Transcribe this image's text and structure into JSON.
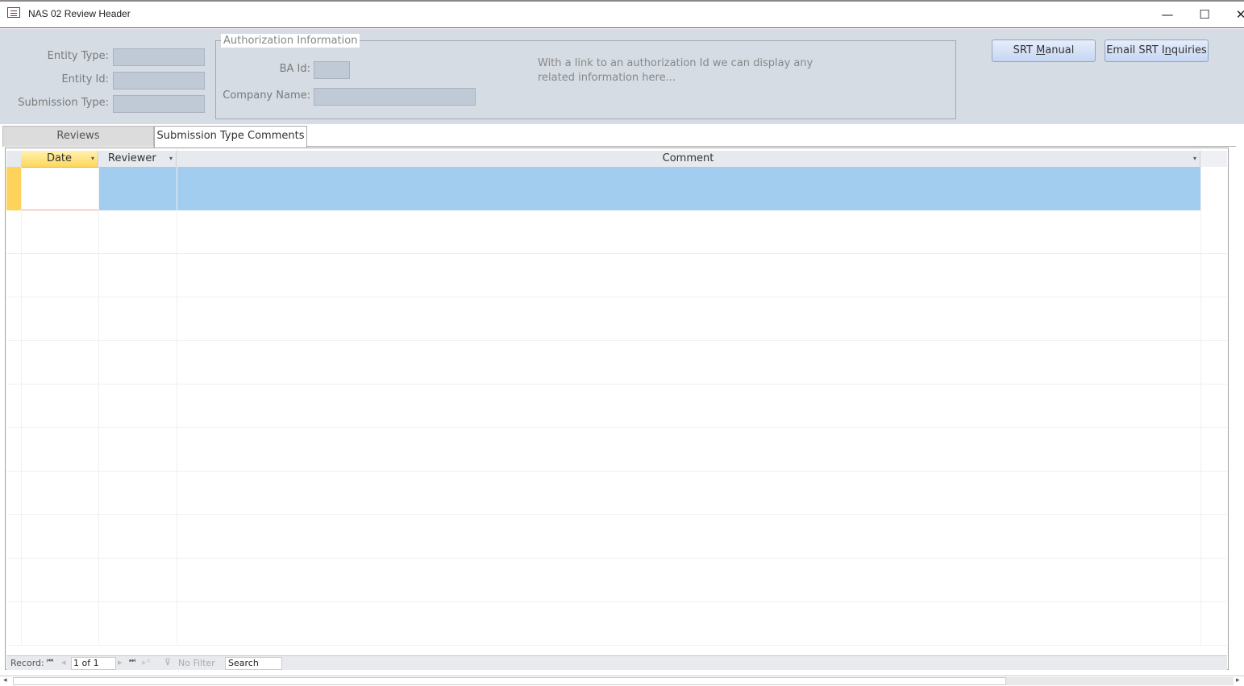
{
  "window": {
    "title": "NAS 02 Review Header",
    "minimize": "—",
    "maximize": "☐",
    "close": "✕"
  },
  "header": {
    "entity_type_label": "Entity Type:",
    "entity_id_label": "Entity Id:",
    "submission_type_label": "Submission Type:",
    "auth_group_title": "Authorization Information",
    "ba_id_label": "BA Id:",
    "company_name_label": "Company Name:",
    "info_text_1": "With a link to an authorization Id we can display any",
    "info_text_2": "related information here...",
    "srt_manual_pre": "SRT ",
    "srt_manual_u": "M",
    "srt_manual_post": "anual",
    "email_pre": "Email SRT I",
    "email_u": "n",
    "email_post": "quiries"
  },
  "tabs": [
    {
      "label": "Reviews"
    },
    {
      "label": "Submission Type Comments",
      "active": true
    }
  ],
  "grid": {
    "columns": [
      "Date",
      "Reviewer",
      "Comment"
    ],
    "dropdown_icon": "▾"
  },
  "navbar": {
    "record_label": "Record:",
    "first": "⏮",
    "prev": "◂",
    "position": "1 of 1",
    "next": "▸",
    "last": "⏭",
    "new": "▸*",
    "filter_label": "No Filter",
    "search_placeholder": "Search"
  },
  "colors": {
    "selected_row": "#a3cdef",
    "active_header": "#fde58a",
    "header_bg": "#d6dce4"
  }
}
